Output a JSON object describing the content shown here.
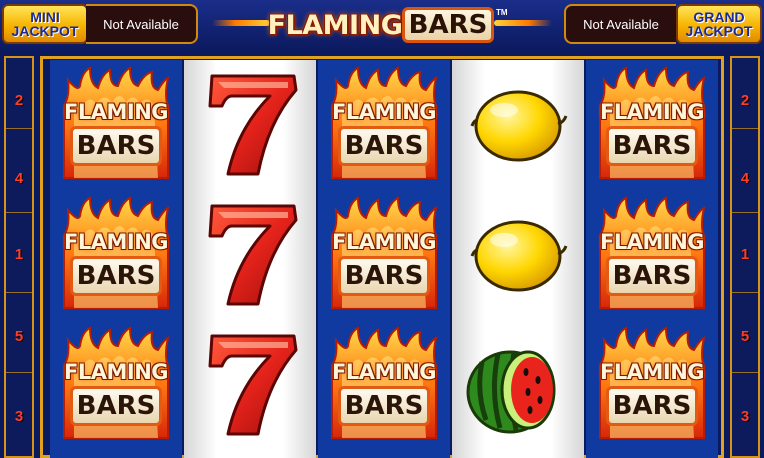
{
  "header": {
    "mini_jackpot": {
      "line1": "MINI",
      "line2": "JACKPOT",
      "value": "Not Available"
    },
    "grand_jackpot": {
      "line1": "GRAND",
      "line2": "JACKPOT",
      "value": "Not Available"
    },
    "logo": {
      "word1": "FLAMING",
      "word2": "BARS",
      "tm": "TM"
    }
  },
  "paylines": {
    "left": [
      "2",
      "4",
      "1",
      "5",
      "3"
    ],
    "right": [
      "2",
      "4",
      "1",
      "5",
      "3"
    ]
  },
  "symbols": {
    "flaming_bars": {
      "line1": "FLAMING",
      "line2": "BARS"
    }
  },
  "reels": [
    [
      "flaming-bars",
      "flaming-bars",
      "flaming-bars"
    ],
    [
      "seven",
      "seven",
      "seven"
    ],
    [
      "flaming-bars",
      "flaming-bars",
      "flaming-bars"
    ],
    [
      "lemon",
      "lemon",
      "watermelon"
    ],
    [
      "flaming-bars",
      "flaming-bars",
      "flaming-bars"
    ]
  ],
  "colors": {
    "background": "#0b1a5e",
    "frame_gold": "#e0a11c",
    "payline_number": "#ff3b2a",
    "seven_red": "#e4231b"
  }
}
